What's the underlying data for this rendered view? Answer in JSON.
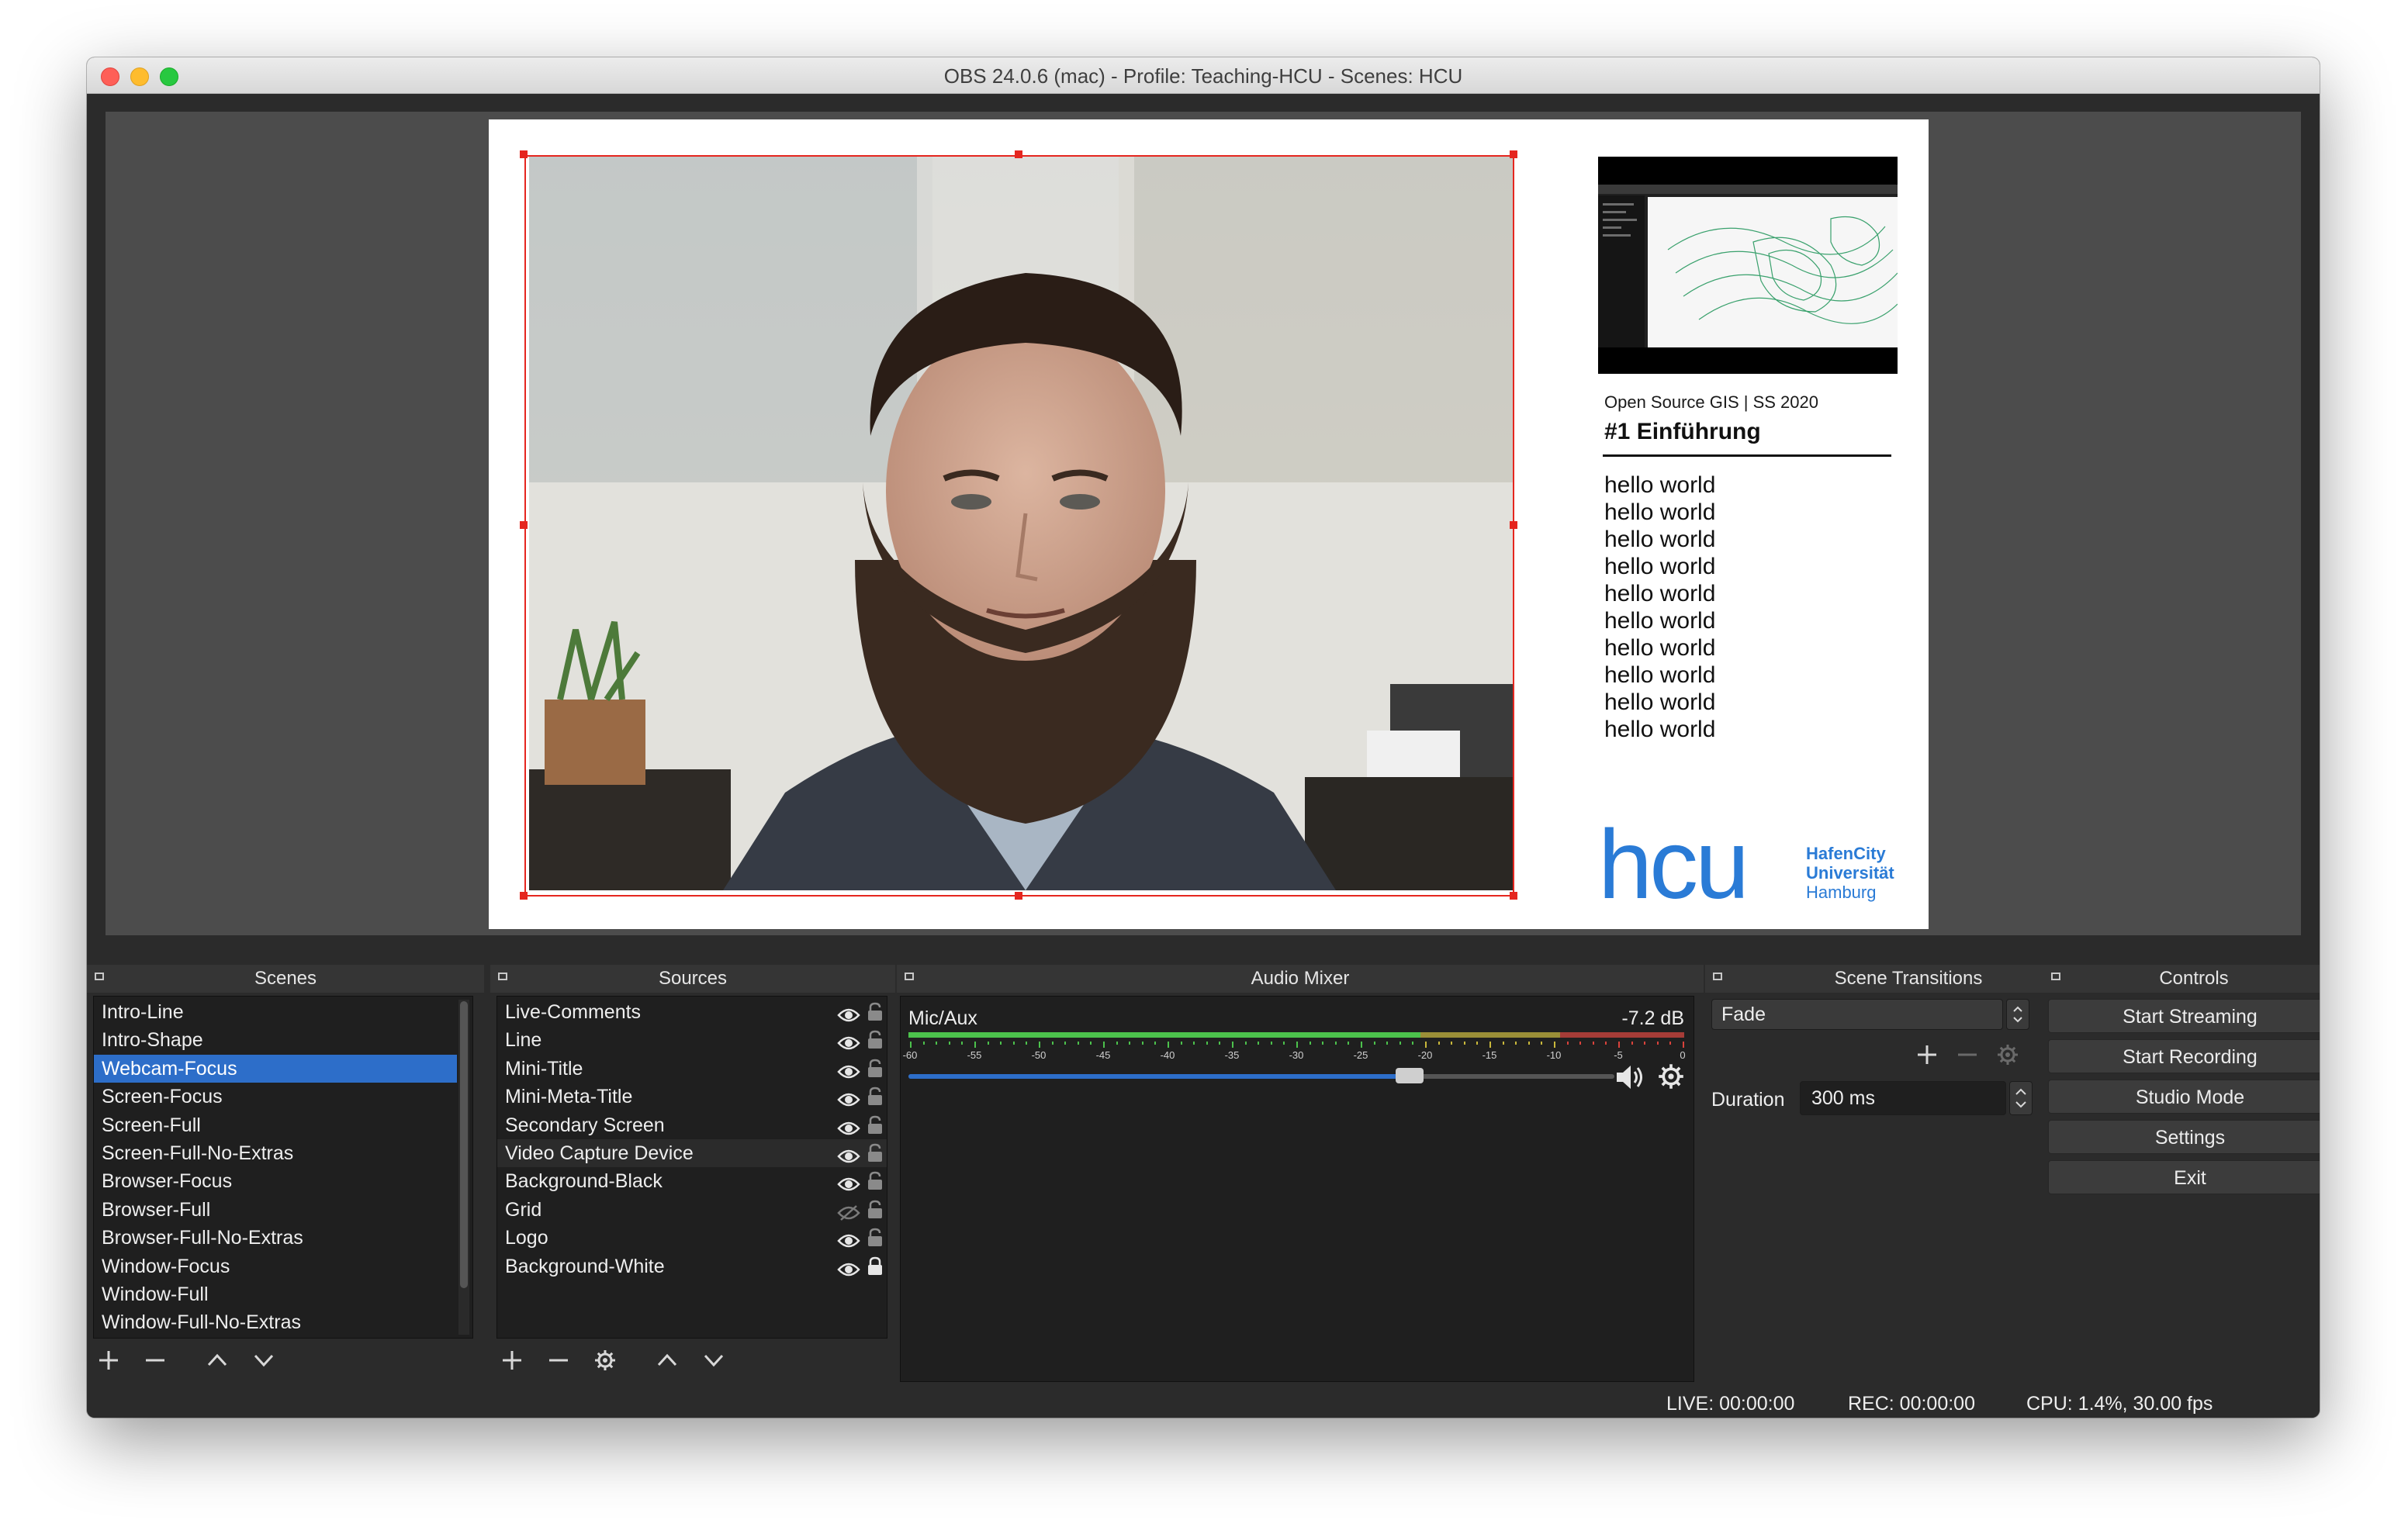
{
  "window": {
    "title": "OBS 24.0.6 (mac) - Profile: Teaching-HCU - Scenes: HCU"
  },
  "preview": {
    "course_subtitle": "Open Source GIS | SS 2020",
    "course_title": "#1 Einführung",
    "hello_lines": [
      "hello world",
      "hello world",
      "hello world",
      "hello world",
      "hello world",
      "hello world",
      "hello world",
      "hello world",
      "hello world",
      "hello world"
    ],
    "logo_text": "hcu",
    "logo_lines": [
      "HafenCity",
      "Universität",
      "Hamburg"
    ],
    "logo_color": "#2a7bd6",
    "selection_color": "#e5261f"
  },
  "scenes": {
    "title": "Scenes",
    "items": [
      "Intro-Line",
      "Intro-Shape",
      "Webcam-Focus",
      "Screen-Focus",
      "Screen-Full",
      "Screen-Full-No-Extras",
      "Browser-Focus",
      "Browser-Full",
      "Browser-Full-No-Extras",
      "Window-Focus",
      "Window-Full",
      "Window-Full-No-Extras"
    ],
    "selected": "Webcam-Focus",
    "toolbar_icons": [
      "plus-icon",
      "minus-icon",
      "chevron-up-icon",
      "chevron-down-icon"
    ]
  },
  "sources": {
    "title": "Sources",
    "items": [
      {
        "name": "Live-Comments",
        "visible": true,
        "locked": false
      },
      {
        "name": "Line",
        "visible": true,
        "locked": false
      },
      {
        "name": "Mini-Title",
        "visible": true,
        "locked": false
      },
      {
        "name": "Mini-Meta-Title",
        "visible": true,
        "locked": false
      },
      {
        "name": "Secondary Screen",
        "visible": true,
        "locked": false
      },
      {
        "name": "Video Capture Device",
        "visible": true,
        "locked": false
      },
      {
        "name": "Background-Black",
        "visible": true,
        "locked": false
      },
      {
        "name": "Grid",
        "visible": false,
        "locked": false
      },
      {
        "name": "Logo",
        "visible": true,
        "locked": false
      },
      {
        "name": "Background-White",
        "visible": true,
        "locked": true
      }
    ],
    "toolbar_icons": [
      "plus-icon",
      "minus-icon",
      "gear-icon",
      "chevron-up-icon",
      "chevron-down-icon"
    ]
  },
  "audio_mixer": {
    "title": "Audio Mixer",
    "track": {
      "name": "Mic/Aux",
      "level": "-7.2 dB",
      "volume_fraction": 0.71,
      "scale_labels": [
        "-60",
        "-55",
        "-50",
        "-45",
        "-40",
        "-35",
        "-30",
        "-25",
        "-20",
        "-15",
        "-10",
        "-5",
        "0"
      ]
    },
    "colors": {
      "green": "#4cc24c",
      "yellow": "#c9b83b",
      "red": "#d9423b",
      "accent": "#2d6ec9"
    }
  },
  "transitions": {
    "title": "Scene Transitions",
    "selected": "Fade",
    "duration_label": "Duration",
    "duration_value": "300 ms"
  },
  "controls": {
    "title": "Controls",
    "buttons": [
      "Start Streaming",
      "Start Recording",
      "Studio Mode",
      "Settings",
      "Exit"
    ]
  },
  "status": {
    "live": "LIVE: 00:00:00",
    "rec": "REC: 00:00:00",
    "cpu": "CPU: 1.4%, 30.00 fps"
  }
}
